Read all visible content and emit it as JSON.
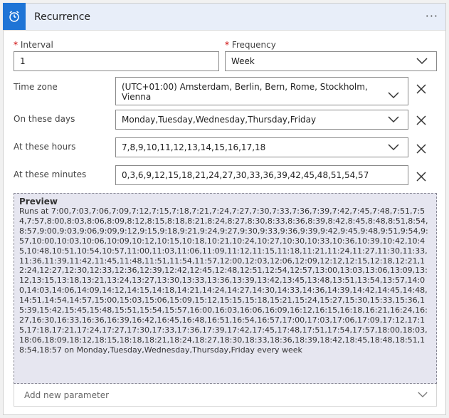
{
  "header": {
    "title": "Recurrence",
    "more": "···"
  },
  "interval": {
    "label": "Interval",
    "value": "1"
  },
  "frequency": {
    "label": "Frequency",
    "value": "Week"
  },
  "timezone": {
    "label": "Time zone",
    "value": "(UTC+01:00) Amsterdam, Berlin, Bern, Rome, Stockholm, Vienna"
  },
  "days": {
    "label": "On these days",
    "value": "Monday,Tuesday,Wednesday,Thursday,Friday"
  },
  "hours": {
    "label": "At these hours",
    "value": "7,8,9,10,11,12,13,14,15,16,17,18"
  },
  "minutes": {
    "label": "At these minutes",
    "value": "0,3,6,9,12,15,18,21,24,27,30,33,36,39,42,45,48,51,54,57"
  },
  "preview": {
    "title": "Preview",
    "text": "Runs at 7:00,7:03,7:06,7:09,7:12,7:15,7:18,7:21,7:24,7:27,7:30,7:33,7:36,7:39,7:42,7:45,7:48,7:51,7:54,7:57,8:00,8:03,8:06,8:09,8:12,8:15,8:18,8:21,8:24,8:27,8:30,8:33,8:36,8:39,8:42,8:45,8:48,8:51,8:54,8:57,9:00,9:03,9:06,9:09,9:12,9:15,9:18,9:21,9:24,9:27,9:30,9:33,9:36,9:39,9:42,9:45,9:48,9:51,9:54,9:57,10:00,10:03,10:06,10:09,10:12,10:15,10:18,10:21,10:24,10:27,10:30,10:33,10:36,10:39,10:42,10:45,10:48,10:51,10:54,10:57,11:00,11:03,11:06,11:09,11:12,11:15,11:18,11:21,11:24,11:27,11:30,11:33,11:36,11:39,11:42,11:45,11:48,11:51,11:54,11:57,12:00,12:03,12:06,12:09,12:12,12:15,12:18,12:21,12:24,12:27,12:30,12:33,12:36,12:39,12:42,12:45,12:48,12:51,12:54,12:57,13:00,13:03,13:06,13:09,13:12,13:15,13:18,13:21,13:24,13:27,13:30,13:33,13:36,13:39,13:42,13:45,13:48,13:51,13:54,13:57,14:00,14:03,14:06,14:09,14:12,14:15,14:18,14:21,14:24,14:27,14:30,14:33,14:36,14:39,14:42,14:45,14:48,14:51,14:54,14:57,15:00,15:03,15:06,15:09,15:12,15:15,15:18,15:21,15:24,15:27,15:30,15:33,15:36,15:39,15:42,15:45,15:48,15:51,15:54,15:57,16:00,16:03,16:06,16:09,16:12,16:15,16:18,16:21,16:24,16:27,16:30,16:33,16:36,16:39,16:42,16:45,16:48,16:51,16:54,16:57,17:00,17:03,17:06,17:09,17:12,17:15,17:18,17:21,17:24,17:27,17:30,17:33,17:36,17:39,17:42,17:45,17:48,17:51,17:54,17:57,18:00,18:03,18:06,18:09,18:12,18:15,18:18,18:21,18:24,18:27,18:30,18:33,18:36,18:39,18:42,18:45,18:48,18:51,18:54,18:57 on Monday,Tuesday,Wednesday,Thursday,Friday every week"
  },
  "add_param": {
    "placeholder": "Add new parameter"
  },
  "icons": {
    "header": "alarm-clock-icon",
    "dropdown": "chevron-down-icon",
    "remove": "close-icon"
  },
  "colors": {
    "accent": "#1e74d6",
    "header_bg": "#e8eef9",
    "preview_bg": "#e6e6f0",
    "required": "#cc0000"
  }
}
